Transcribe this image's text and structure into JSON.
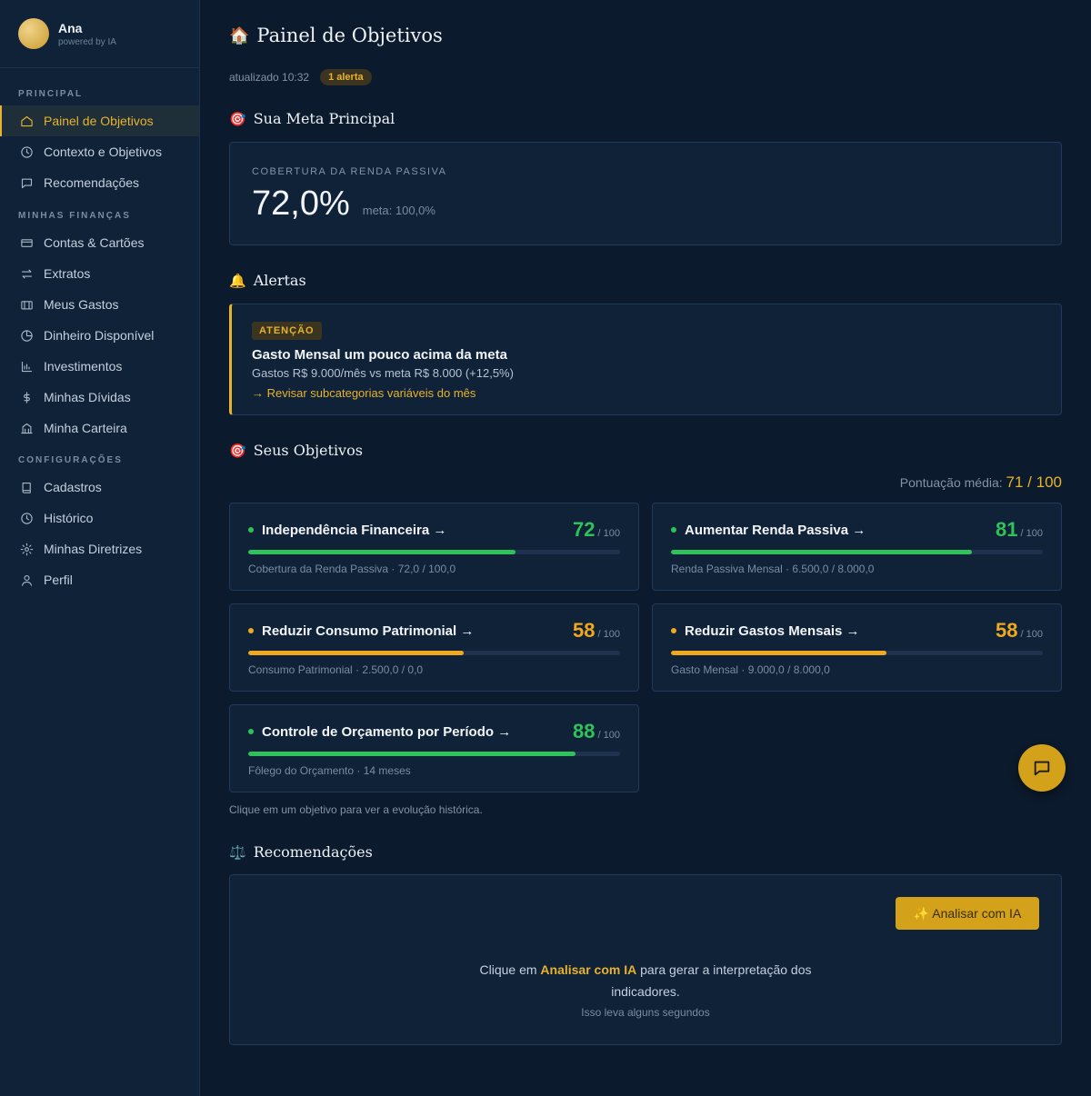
{
  "profile": {
    "name": "Ana",
    "subtitle": "powered by IA"
  },
  "sidebar": {
    "sections": [
      {
        "label": "PRINCIPAL",
        "items": [
          {
            "label": "Painel de Objetivos",
            "icon": "home-icon",
            "active": true
          },
          {
            "label": "Contexto e Objetivos",
            "icon": "clock-icon"
          },
          {
            "label": "Recomendações",
            "icon": "chat-icon"
          }
        ]
      },
      {
        "label": "MINHAS FINANÇAS",
        "items": [
          {
            "label": "Contas & Cartões",
            "icon": "card-icon"
          },
          {
            "label": "Extratos",
            "icon": "transfer-icon"
          },
          {
            "label": "Meus Gastos",
            "icon": "wallet-icon"
          },
          {
            "label": "Dinheiro Disponível",
            "icon": "pie-icon"
          },
          {
            "label": "Investimentos",
            "icon": "bar-chart-icon"
          },
          {
            "label": "Minhas Dívidas",
            "icon": "dollar-icon"
          },
          {
            "label": "Minha Carteira",
            "icon": "bank-icon"
          }
        ]
      },
      {
        "label": "CONFIGURAÇÕES",
        "items": [
          {
            "label": "Cadastros",
            "icon": "book-icon"
          },
          {
            "label": "Histórico",
            "icon": "clock-icon"
          },
          {
            "label": "Minhas Diretrizes",
            "icon": "gear-icon"
          },
          {
            "label": "Perfil",
            "icon": "user-icon"
          }
        ]
      }
    ]
  },
  "header": {
    "emoji": "🏠",
    "title": "Painel de Objetivos",
    "updated": "atualizado 10:32",
    "alert_badge": "1 alerta"
  },
  "main_goal": {
    "emoji": "🎯",
    "heading": "Sua Meta Principal",
    "label": "COBERTURA DA RENDA PASSIVA",
    "value": "72,0%",
    "target": "meta: 100,0%"
  },
  "alerts": {
    "emoji": "🔔",
    "heading": "Alertas",
    "tag": "ATENÇÃO",
    "title": "Gasto Mensal um pouco acima da meta",
    "description": "Gastos R$ 9.000/mês vs meta R$ 8.000 (+12,5%)",
    "action": "→ Revisar subcategorias variáveis do mês"
  },
  "objectives": {
    "emoji": "🎯",
    "heading": "Seus Objetivos",
    "avg_label": "Pontuação média:",
    "avg_value": "71 / 100",
    "colors": {
      "green": "#2fc25a",
      "orange": "#f0a81e"
    },
    "items": [
      {
        "title": "Independência Financeira →",
        "score": "72",
        "max": "/ 100",
        "progress": 0.72,
        "color": "green",
        "sub": "Cobertura da Renda Passiva · 72,0 / 100,0"
      },
      {
        "title": "Aumentar Renda Passiva →",
        "score": "81",
        "max": "/ 100",
        "progress": 0.81,
        "color": "green",
        "sub": "Renda Passiva Mensal · 6.500,0 / 8.000,0"
      },
      {
        "title": "Reduzir Consumo Patrimonial →",
        "score": "58",
        "max": "/ 100",
        "progress": 0.58,
        "color": "orange",
        "sub": "Consumo Patrimonial · 2.500,0 / 0,0"
      },
      {
        "title": "Reduzir Gastos Mensais →",
        "score": "58",
        "max": "/ 100",
        "progress": 0.58,
        "color": "orange",
        "sub": "Gasto Mensal · 9.000,0 / 8.000,0"
      },
      {
        "title": "Controle de Orçamento por Período →",
        "score": "88",
        "max": "/ 100",
        "progress": 0.88,
        "color": "green",
        "sub": "Fôlego do Orçamento · 14 meses"
      }
    ],
    "hint": "Clique em um objetivo para ver a evolução histórica."
  },
  "recommendations": {
    "emoji": "⚖️",
    "heading": "Recomendações",
    "button": "✨ Analisar com IA",
    "text_before": "Clique em ",
    "text_highlight": "Analisar com IA",
    "text_after": " para gerar a interpretação dos indicadores.",
    "note": "Isso leva alguns segundos"
  }
}
